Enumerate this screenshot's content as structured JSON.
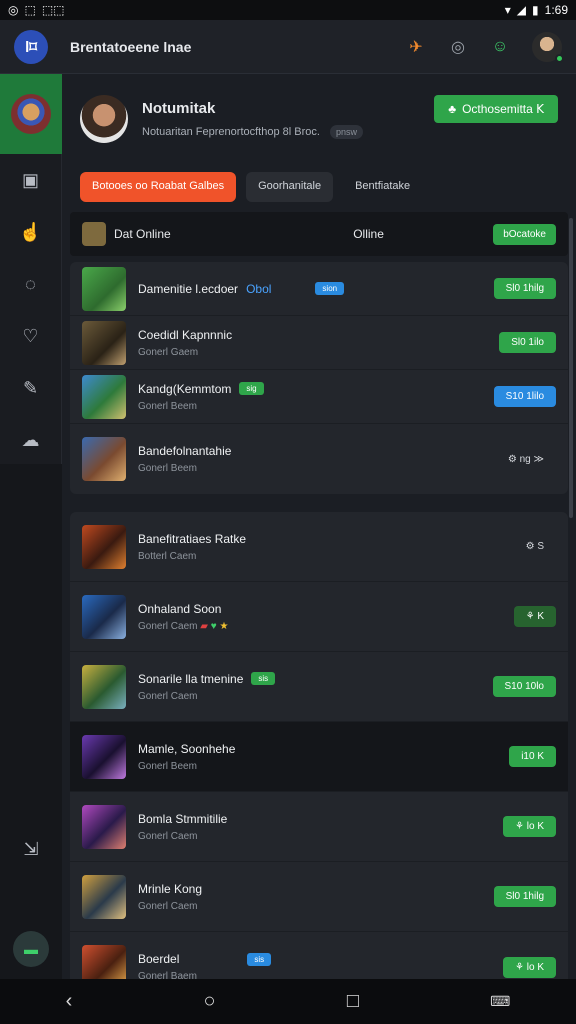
{
  "status": {
    "left_icons": [
      "◎",
      "⬚",
      "⬚⬚"
    ],
    "time": "1:69"
  },
  "header": {
    "logo_text": "l⌑",
    "title": "Brentatoeene lnae"
  },
  "profile": {
    "name": "Notumitak",
    "subtitle": "Notuaritan Feprenortocfthop 8l Broc.",
    "tag": "pnsw",
    "button_label": "Octhosemitta 𝖪"
  },
  "tabs": [
    "Botooes oo Roabat Galbes",
    "Goorhanitale",
    "Bentfiatake"
  ],
  "list_header": {
    "title": "Dat Online",
    "status": "Olline",
    "button": "bOcatoke"
  },
  "rows": [
    {
      "name": "Damenitie l.ecdoer",
      "extra": "Obol",
      "sub": "",
      "badge": "sion",
      "badge_color": "blue",
      "button": "Sl0 1hilg",
      "button_style": "green"
    },
    {
      "name": "Coedidl Kapnnnic",
      "extra": "",
      "sub": "Gonerl Gaem",
      "badge": "",
      "badge_color": "",
      "button": "Sl0 1ilo",
      "button_style": "green"
    },
    {
      "name": "Kandg(Kemmtom",
      "extra": "",
      "sub": "Gonerl Beem",
      "badge": "sig",
      "badge_color": "green",
      "button": "S10 1lilo",
      "button_style": "blue"
    },
    {
      "name": "Bandefolnantahie",
      "extra": "",
      "sub": "Gonerl Beem",
      "badge": "",
      "badge_color": "",
      "button": "⚙ ng ≫",
      "button_style": "plain"
    }
  ],
  "rows2": [
    {
      "name": "Banefitratiaes Ratke",
      "sub": "Botterl Caem",
      "badge": "",
      "badge_color": "",
      "button": "⚙ S",
      "button_style": "plain"
    },
    {
      "name": "Onhaland Soon",
      "sub": "Gonerl Caem",
      "badge": "",
      "badge_color": "",
      "button": "⚘ K",
      "button_style": "dgreen"
    },
    {
      "name": "Sonarile lla tmenine",
      "sub": "Gonerl Caem",
      "badge": "sis",
      "badge_color": "green",
      "button": "S10 10lo",
      "button_style": "green"
    },
    {
      "name": "Mamle, Soonhehe",
      "sub": "Gonerl Beem",
      "badge": "",
      "badge_color": "",
      "button": "i10 K",
      "button_style": "green"
    },
    {
      "name": "Bomla Stmmitilie",
      "sub": "Gonerl Caem",
      "badge": "",
      "badge_color": "",
      "button": "⚘ lo K",
      "button_style": "green"
    },
    {
      "name": "Mrinle Kong",
      "sub": "Gonerl Caem",
      "badge": "",
      "badge_color": "",
      "button": "Sl0 1hilg",
      "button_style": "green"
    },
    {
      "name": "Boerdel",
      "sub": "Gonerl Baem",
      "badge": "sis",
      "badge_color": "blue",
      "button": "⚘ lo K",
      "button_style": "green"
    }
  ],
  "colors": {
    "accent_green": "#2fa54a",
    "accent_orange": "#f0532a",
    "accent_blue": "#2a8be0"
  }
}
